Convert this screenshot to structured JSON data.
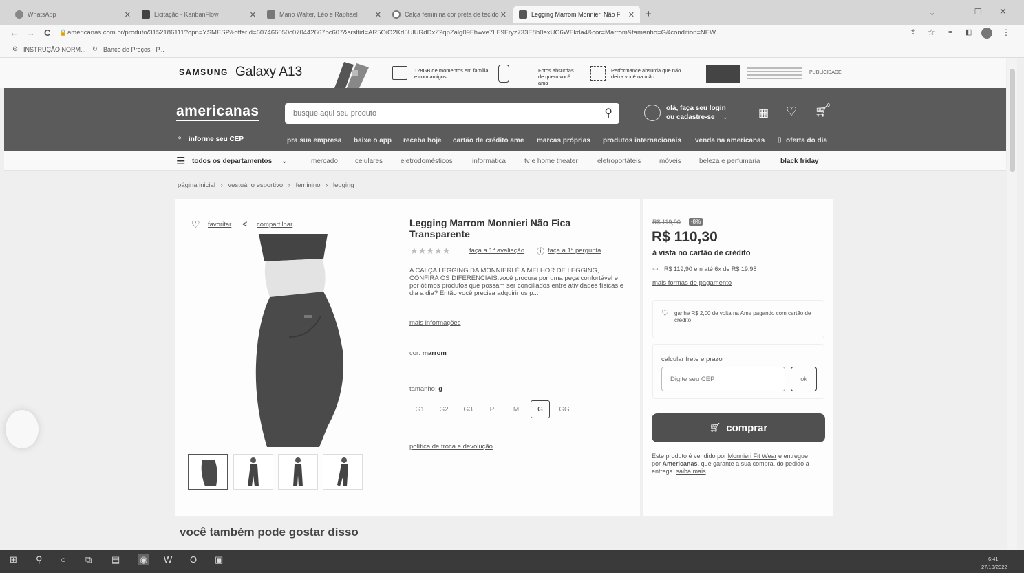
{
  "browser": {
    "tabs": [
      {
        "label": "WhatsApp"
      },
      {
        "label": "Licitação - KanbanFlow"
      },
      {
        "label": "Mano Walter, Léo e Raphael"
      },
      {
        "label": "Calça feminina cor preta de tecido"
      },
      {
        "label": "Legging Marrom Monnieri Não F"
      }
    ],
    "url": "americanas.com.br/produto/3152186111?opn=YSMESP&offerId=607466050c070442667bc607&srsltid=AR5OiO2Kd5UlURdDxZ2qpZalg09Fhwve7LE9Fryz733E8h0exUC6WFkda4&cor=Marrom&tamanho=G&condition=NEW",
    "bookmarks": [
      "INSTRUÇÃO NORM...",
      "Banco de Preços - P..."
    ]
  },
  "ad": {
    "brand": "SAMSUNG",
    "model": "Galaxy A13",
    "feature1": "128GB de momentos em família e com amigos",
    "feature2": "Fotos absurdas de quem você ama",
    "feature3": "Performance absurda que não deixa você na mão",
    "tag": "PUBLICIDADE"
  },
  "header": {
    "logo": "americanas",
    "search_placeholder": "busque aqui seu produto",
    "login_line1": "olá, faça seu login",
    "login_line2": "ou cadastre-se",
    "cep": "informe seu CEP",
    "cart_count": "0",
    "nav": [
      "pra sua empresa",
      "baixe o app",
      "receba hoje",
      "cartão de crédito ame",
      "marcas próprias",
      "produtos internacionais",
      "venda na americanas",
      "oferta do dia"
    ]
  },
  "catbar": {
    "all": "todos os departamentos",
    "items": [
      "mercado",
      "celulares",
      "eletrodomésticos",
      "informática",
      "tv e home theater",
      "eletroportáteis",
      "móveis",
      "beleza e perfumaria",
      "black friday"
    ]
  },
  "breadcrumb": [
    "página inicial",
    "vestuário esportivo",
    "feminino",
    "legging"
  ],
  "product": {
    "favorite": "favoritar",
    "share": "compartilhar",
    "title": "Legging Marrom Monnieri Não Fica Transparente",
    "review_link": "faça a 1ª avaliação",
    "question_link": "faça a 1ª pergunta",
    "description": "A CALÇA LEGGING DA MONNIERI É A MELHOR DE LEGGING, CONFIRA OS DIFERENCIAIS:você procura por uma peça confortável e por ótimos produtos que possam ser conciliados entre atividades físicas e dia a dia? Então você precisa adquirir os p...",
    "more_info": "mais informações",
    "color_label": "cor:",
    "color_value": "marrom",
    "size_label": "tamanho:",
    "size_value": "g",
    "sizes": [
      "G1",
      "G2",
      "G3",
      "P",
      "M",
      "G",
      "GG"
    ],
    "selected_size": "G",
    "return_policy": "política de troca e devolução"
  },
  "pricing": {
    "old_price": "R$ 119,90",
    "discount": "-8%",
    "price": "R$ 110,30",
    "price_note": "à vista no cartão de crédito",
    "installments": "R$ 119,90 em até 6x de R$ 19,98",
    "more_payment": "mais formas de pagamento",
    "cashback": "ganhe R$ 2,00 de volta na Ame pagando com cartão de crédito",
    "shipping_label": "calcular frete e prazo",
    "cep_placeholder": "Digite seu CEP",
    "ok": "ok",
    "buy": "comprar",
    "seller_prefix": "Este produto é vendido por",
    "seller": "Monnieri Fit Wear",
    "seller_mid": "e entregue por",
    "deliverer": "Americanas",
    "seller_suffix": ", que garante a sua compra, do pedido à entrega.",
    "learn_more": "saiba mais"
  },
  "recommend_title": "você também pode gostar disso",
  "taskbar": {
    "time": "6:41",
    "date": "27/10/2022"
  }
}
